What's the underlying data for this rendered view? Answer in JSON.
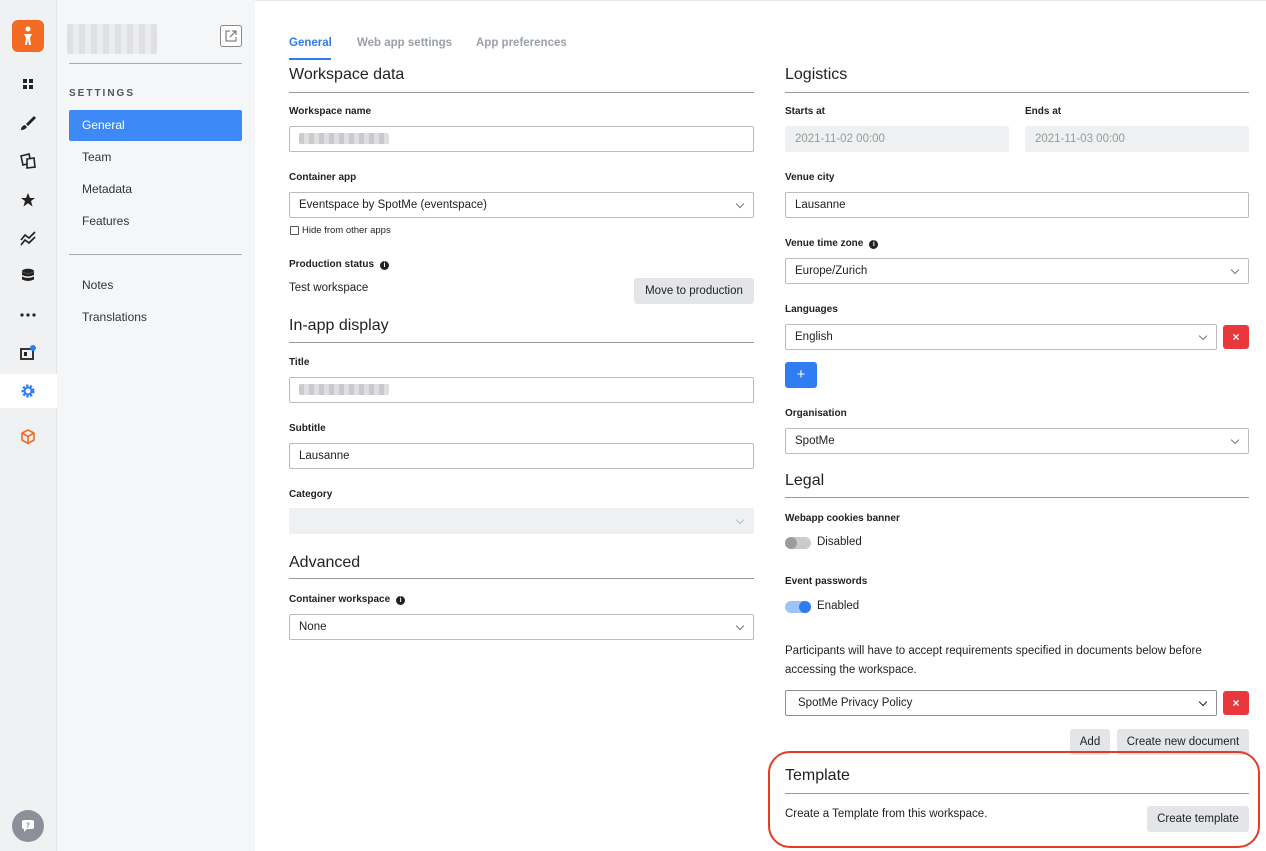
{
  "sidebar": {
    "section_title": "SETTINGS",
    "items": [
      {
        "label": "General",
        "active": true
      },
      {
        "label": "Team"
      },
      {
        "label": "Metadata"
      },
      {
        "label": "Features"
      }
    ],
    "items2": [
      {
        "label": "Notes"
      },
      {
        "label": "Translations"
      }
    ]
  },
  "rail_icons": [
    "grid-icon",
    "brush-icon",
    "pages-icon",
    "star-icon",
    "analytics-icon",
    "database-icon",
    "more-icon",
    "store-icon",
    "settings-icon",
    "package-icon",
    "help-icon"
  ],
  "colors": {
    "accent": "#2f7df0",
    "brand": "#f36a22",
    "danger": "#e8383b"
  },
  "tabs": [
    {
      "label": "General",
      "active": true
    },
    {
      "label": "Web app settings"
    },
    {
      "label": "App preferences"
    }
  ],
  "workspace_data": {
    "title": "Workspace data",
    "name_label": "Workspace name",
    "container_app_label": "Container app",
    "container_app_value": "Eventspace by SpotMe (eventspace)",
    "hide_label": "Hide from other apps",
    "production_status_label": "Production status",
    "production_status_value": "Test workspace",
    "move_button": "Move to production"
  },
  "in_app_display": {
    "title": "In-app display",
    "title_label": "Title",
    "subtitle_label": "Subtitle",
    "subtitle_value": "Lausanne",
    "category_label": "Category"
  },
  "advanced": {
    "title": "Advanced",
    "container_workspace_label": "Container workspace",
    "container_workspace_value": "None"
  },
  "logistics": {
    "title": "Logistics",
    "starts_label": "Starts at",
    "starts_value": "2021-11-02 00:00",
    "ends_label": "Ends at",
    "ends_value": "2021-11-03 00:00",
    "venue_city_label": "Venue city",
    "venue_city_value": "Lausanne",
    "timezone_label": "Venue time zone",
    "timezone_value": "Europe/Zurich",
    "languages_label": "Languages",
    "language_value": "English",
    "remove_symbol": "×",
    "add_symbol": "+",
    "organisation_label": "Organisation",
    "organisation_value": "SpotMe"
  },
  "legal": {
    "title": "Legal",
    "cookies_label": "Webapp cookies banner",
    "cookies_state": "Disabled",
    "passwords_label": "Event passwords",
    "passwords_state": "Enabled",
    "notice": "Participants will have to accept requirements specified in documents below before accessing the workspace.",
    "document_value": "SpotMe Privacy Policy",
    "add_button": "Add",
    "create_doc_button": "Create new document"
  },
  "template": {
    "title": "Template",
    "description": "Create a Template from this workspace.",
    "create_button": "Create template"
  }
}
